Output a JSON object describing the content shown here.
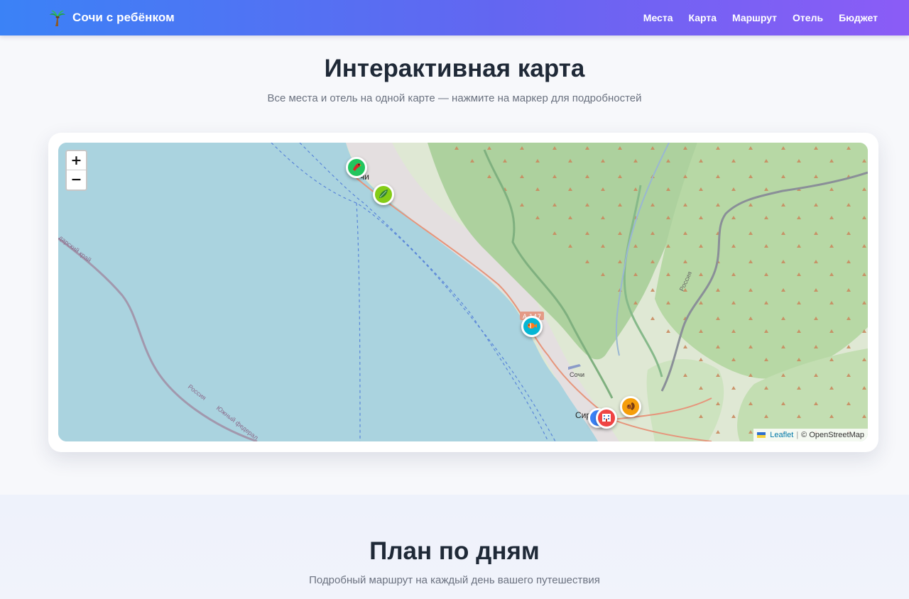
{
  "header": {
    "logo_icon": "palm-tree-icon",
    "title": "Сочи с ребёнком",
    "nav": [
      "Места",
      "Карта",
      "Маршрут",
      "Отель",
      "Бюджет"
    ]
  },
  "map_section": {
    "title": "Интерактивная карта",
    "subtitle": "Все места и отель на одной карте — нажмите на маркер для подробностей",
    "zoom_in": "+",
    "zoom_out": "−",
    "map_labels": {
      "city_top": "чи",
      "city_mid": "Сочи",
      "city_bottom": "Сир",
      "region": "дарский край",
      "border_1": "Россия",
      "border_2": "Южный федерал",
      "road_a147": "A 147",
      "road_russia": "Россия"
    },
    "markers": [
      {
        "icon": "parrot-icon",
        "color": "#22c55e"
      },
      {
        "icon": "leaf-icon",
        "color": "#84cc16"
      },
      {
        "icon": "fish-icon",
        "color": "#06b6d4"
      },
      {
        "icon": "squirrel-icon",
        "color": "#f59e0b"
      },
      {
        "icon": "pin-icon",
        "color": "#3b82f6"
      },
      {
        "icon": "hotel-icon",
        "color": "#ef4444"
      }
    ],
    "attribution": {
      "leaflet": "Leaflet",
      "separator": "|",
      "osm": "© OpenStreetMap"
    }
  },
  "days_section": {
    "title": "План по дням",
    "subtitle": "Подробный маршрут на каждый день вашего путешествия"
  }
}
